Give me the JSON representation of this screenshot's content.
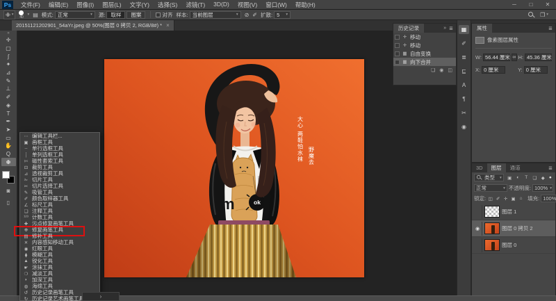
{
  "menu_bar": {
    "logo": "Ps",
    "items": [
      "文件(F)",
      "编辑(E)",
      "图像(I)",
      "图层(L)",
      "文字(Y)",
      "选择(S)",
      "滤镜(T)",
      "3D(D)",
      "视图(V)",
      "窗口(W)",
      "帮助(H)"
    ],
    "window_controls": [
      {
        "icon": "─",
        "name": "minimize"
      },
      {
        "icon": "□",
        "name": "maximize"
      },
      {
        "icon": "✕",
        "name": "close"
      }
    ]
  },
  "options_bar": {
    "tool_icon": "✙",
    "brush_size": "40",
    "panel_toggle_icon": "▤",
    "mode_label": "模式:",
    "mode_value": "正常",
    "source_label": "源:",
    "sampled_label": "取样",
    "pattern_label": "图案",
    "aligned_label": "对齐",
    "sample_label": "样本:",
    "sample_value": "当前图层",
    "ignore_adjust_icon": "⊘",
    "pressure_icon": "✐",
    "diffusion_label": "扩散:",
    "diffusion_value": "5",
    "workspace_icon": "❒"
  },
  "tab_bar": {
    "doc_title": "20151121202901_54aYr.jpeg @ 50%(图层 0 拷贝 2, RGB/8#) *",
    "close_icon": "×"
  },
  "toolbar": {
    "expand_icon": "»",
    "tools": [
      {
        "icon": "✛"
      },
      {
        "icon": "▢"
      },
      {
        "icon": "ʃ"
      },
      {
        "icon": "✦"
      },
      {
        "icon": "⊿"
      },
      {
        "icon": "✎"
      },
      {
        "icon": "⊥"
      },
      {
        "icon": "✐"
      },
      {
        "icon": "◈"
      },
      {
        "icon": "T"
      },
      {
        "icon": "✒"
      },
      {
        "icon": "➤"
      },
      {
        "icon": "▭"
      },
      {
        "icon": "✋"
      },
      {
        "icon": "Q"
      },
      {
        "icon": "✙",
        "selected": true
      }
    ],
    "quick_mask_icon": "◙",
    "screen_mode_icon": "▯"
  },
  "flyout": {
    "items": [
      {
        "icon": "⋯",
        "label": "编辑工具栏..."
      },
      {
        "icon": "▣",
        "label": "画框工具"
      },
      {
        "icon": "┄",
        "label": "单行选框工具"
      },
      {
        "icon": "┆",
        "label": "单列选框工具"
      },
      {
        "icon": "✄",
        "label": "磁性套索工具"
      },
      {
        "icon": "⊡",
        "label": "裁剪工具"
      },
      {
        "icon": "⊿",
        "label": "透视裁剪工具"
      },
      {
        "icon": "✁",
        "label": "切片工具"
      },
      {
        "icon": "✂",
        "label": "切片选择工具"
      },
      {
        "icon": "✎",
        "label": "吸管工具"
      },
      {
        "icon": "✐",
        "label": "颜色取样器工具"
      },
      {
        "icon": "∠",
        "label": "标尺工具"
      },
      {
        "icon": "❏",
        "label": "注释工具"
      },
      {
        "icon": "¹²³",
        "label": "计数工具"
      },
      {
        "icon": "✚",
        "label": "污点修复画笔工具"
      },
      {
        "icon": "✙",
        "label": "修复画笔工具",
        "boxed": true
      },
      {
        "icon": "▤",
        "label": "修补工具"
      },
      {
        "icon": "✕",
        "label": "内容感知移动工具"
      },
      {
        "icon": "◉",
        "label": "红眼工具"
      },
      {
        "icon": "⧫",
        "label": "模糊工具"
      },
      {
        "icon": "▲",
        "label": "锐化工具"
      },
      {
        "icon": "☛",
        "label": "涂抹工具"
      },
      {
        "icon": "❍",
        "label": "减淡工具"
      },
      {
        "icon": "◗",
        "label": "加深工具"
      },
      {
        "icon": "◍",
        "label": "海绵工具"
      },
      {
        "icon": "↺",
        "label": "历史记录画笔工具"
      },
      {
        "icon": "↻",
        "label": "历史记录艺术画笔工具"
      }
    ]
  },
  "history": {
    "title": "历史记录",
    "collapse_icon": "»",
    "menu_icon": "≣",
    "items": [
      {
        "icon": "✛",
        "label": "移动"
      },
      {
        "icon": "✛",
        "label": "移动"
      },
      {
        "icon": "▦",
        "label": "自由变换"
      },
      {
        "icon": "▦",
        "label": "向下合并",
        "selected": true
      }
    ],
    "footer_icons": [
      {
        "icon": "❏",
        "name": "new-document-from-state"
      },
      {
        "icon": "◉",
        "name": "new-snapshot"
      },
      {
        "icon": "◫",
        "name": "delete-state"
      }
    ]
  },
  "dock": {
    "icons": [
      {
        "icon": "▦",
        "name": "swatches",
        "selected": true
      },
      {
        "icon": "✐",
        "name": "brushes"
      },
      {
        "icon": "≣",
        "name": "brush-settings"
      },
      {
        "icon": "⊑",
        "name": "clone-source"
      },
      {
        "icon": "A",
        "name": "character"
      },
      {
        "icon": "¶",
        "name": "paragraph"
      },
      {
        "icon": "✂",
        "name": "tool-presets"
      },
      {
        "icon": "◉",
        "name": "navigator"
      }
    ]
  },
  "properties": {
    "tab": "属性",
    "menu_icon": "≣",
    "heading": "像素图层属性",
    "w_label": "W:",
    "w_value": "56.44 厘米",
    "link_icon": "∞",
    "h_label": "H:",
    "h_value": "45.36 厘米",
    "x_label": "X:",
    "x_value": "0 厘米",
    "y_label": "Y:",
    "y_value": "0 厘米"
  },
  "layers": {
    "tabs": [
      {
        "label": "3D"
      },
      {
        "label": "图层",
        "active": true
      },
      {
        "label": "通道"
      }
    ],
    "menu_icon": "≣",
    "filter_label": "类型",
    "filter_icons": [
      {
        "icon": "▣"
      },
      {
        "icon": "◐"
      },
      {
        "icon": "T"
      },
      {
        "icon": "❏"
      },
      {
        "icon": "◆"
      }
    ],
    "filter_toggle_icon": "●",
    "blend_mode": "正常",
    "opacity_label": "不透明度:",
    "opacity_value": "100%",
    "lock_label": "锁定:",
    "lock_icons": [
      {
        "icon": "◫"
      },
      {
        "icon": "✐"
      },
      {
        "icon": "✛"
      },
      {
        "icon": "▣"
      },
      {
        "icon": "⌂"
      }
    ],
    "fill_label": "填充:",
    "fill_value": "100%",
    "rows": [
      {
        "name": "图层 1",
        "checker": true
      },
      {
        "name": "图层 0 拷贝 2",
        "visible": true,
        "selected": true
      },
      {
        "name": "图层 0"
      }
    ]
  },
  "canvas": {
    "tee_letter": "m",
    "tee_badge": "ok",
    "caption1": "大心 两鞋怕水袜",
    "caption2": "野魔去"
  },
  "taskbar": {
    "chevron": "›"
  }
}
